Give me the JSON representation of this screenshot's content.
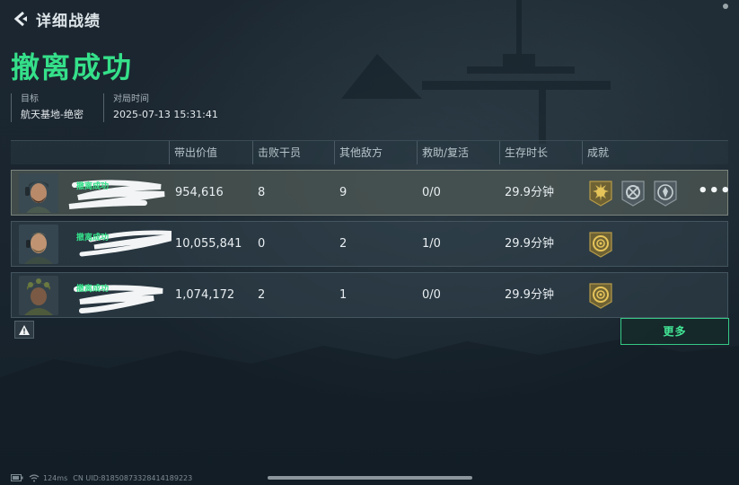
{
  "header": {
    "title": "详细战绩"
  },
  "result": {
    "title": "撤离成功"
  },
  "meta": {
    "target_label": "目标",
    "target_value": "航天基地-绝密",
    "time_label": "对局时间",
    "time_value": "2025-07-13 15:31:41"
  },
  "table": {
    "headers": [
      "带出价值",
      "击败干员",
      "其他敌方",
      "救助/复活",
      "生存时长",
      "成就"
    ],
    "rows": [
      {
        "status": "撤离成功",
        "value": "954,616",
        "kills": "8",
        "others": "9",
        "revive": "0/0",
        "survival": "29.9分钟",
        "achievements": [
          "gold-burst-badge",
          "grey-wreath-badge",
          "grey-crest-badge"
        ],
        "more": "•••"
      },
      {
        "status": "撤离成功",
        "value": "10,055,841",
        "kills": "0",
        "others": "2",
        "revive": "1/0",
        "survival": "29.9分钟",
        "achievements": [
          "gold-target-badge"
        ]
      },
      {
        "status": "撤离成功",
        "value": "1,074,172",
        "kills": "2",
        "others": "1",
        "revive": "0/0",
        "survival": "29.9分钟",
        "achievements": [
          "gold-target-badge"
        ]
      }
    ]
  },
  "buttons": {
    "more": "更多"
  },
  "status": {
    "ping": "124ms",
    "uid": "CN UID:8185087332841418922​3"
  },
  "colors": {
    "accent": "#35e08a",
    "text": "#e9eef1",
    "row_bg": "#30404b",
    "badge_gold": "#8c7a3c"
  }
}
